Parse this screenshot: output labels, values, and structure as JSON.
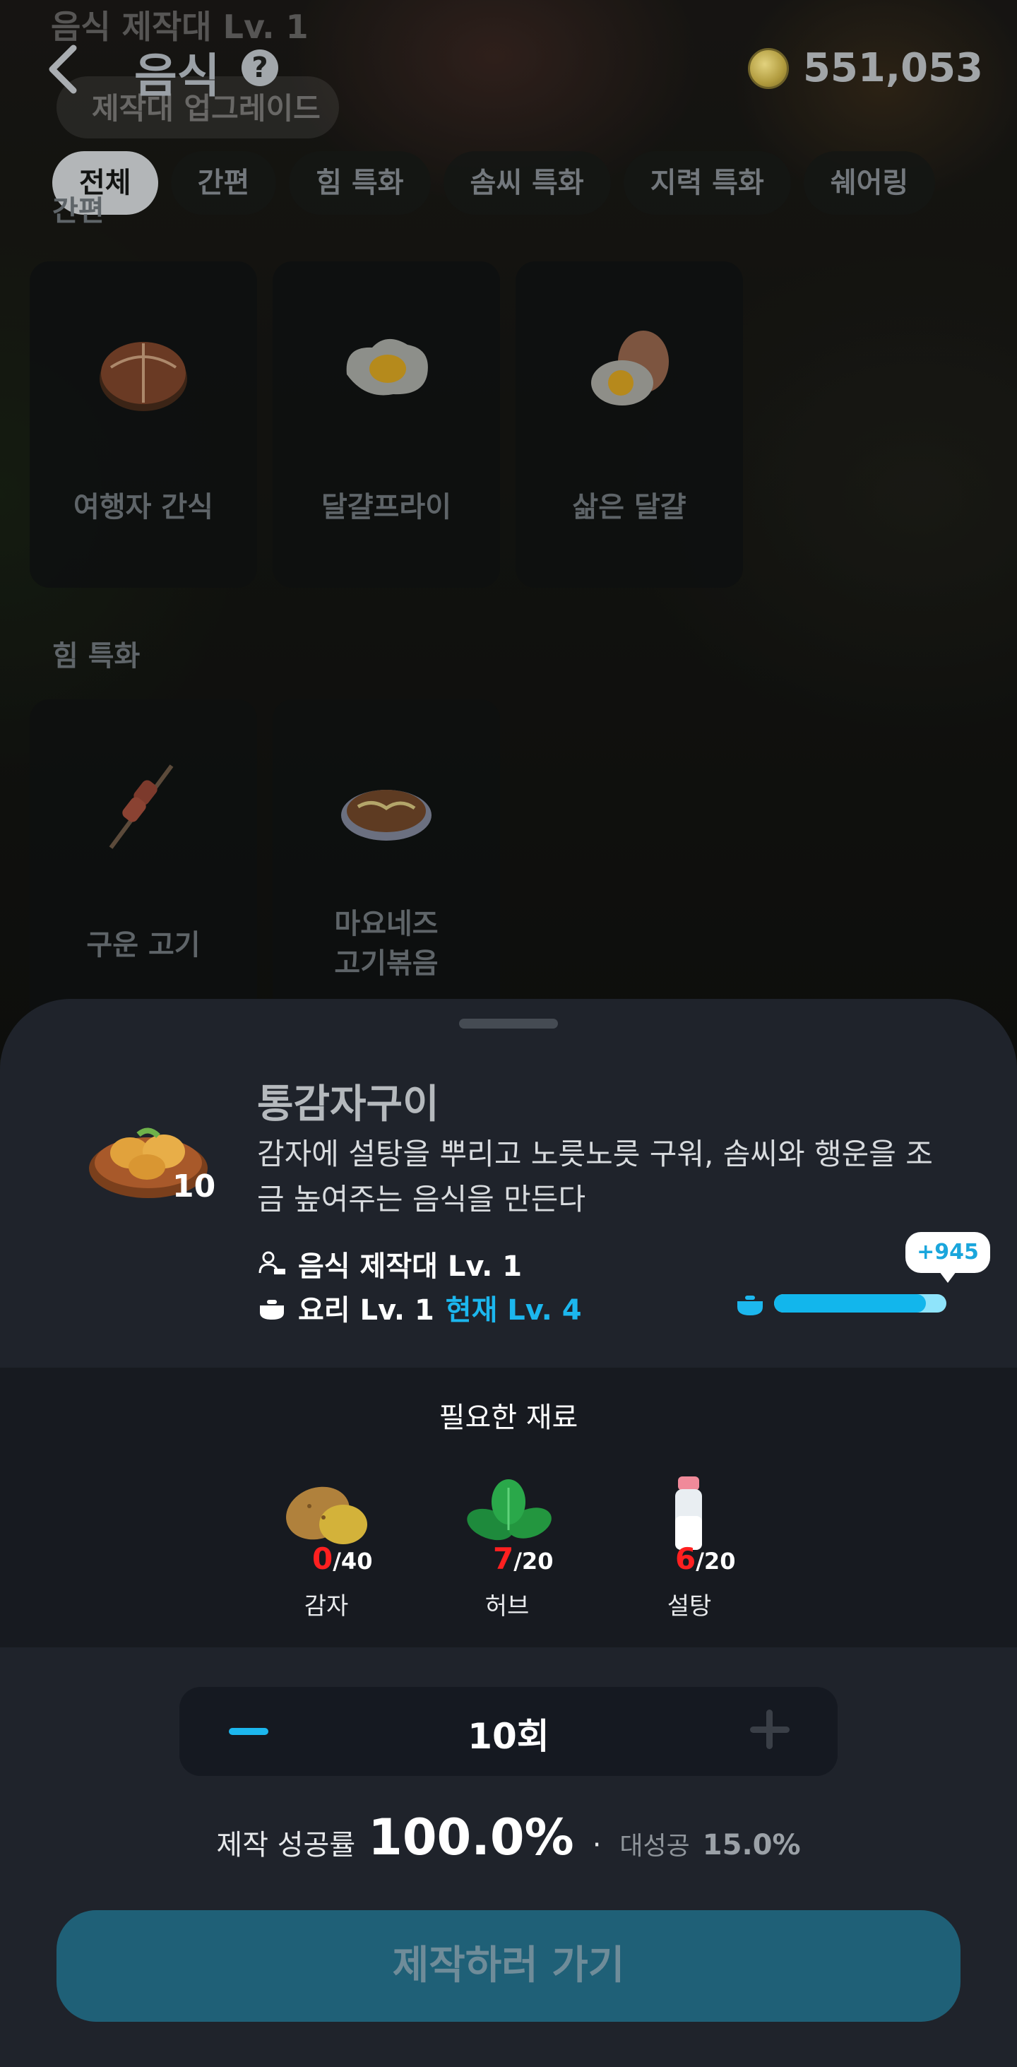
{
  "header": {
    "ghost_title": "음식 제작대 Lv. 1",
    "ghost_upgrade": "제작대 업그레이드",
    "title": "음식",
    "help": "?",
    "coins": "551,053"
  },
  "tabs": [
    "전체",
    "간편",
    "힘 특화",
    "솜씨 특화",
    "지력 특화",
    "쉐어링"
  ],
  "sections": [
    {
      "label": "간편",
      "items": [
        "여행자 간식",
        "달걀프라이",
        "삶은 달걀"
      ]
    },
    {
      "label": "힘 특화",
      "items": [
        "구운 고기",
        "마요네즈\n고기볶음"
      ]
    }
  ],
  "sheet": {
    "recipe_name": "통감자구이",
    "recipe_qty": "10",
    "description": "감자에 설탕을 뿌리고 노릇노릇 구워, 솜씨와 행운을 조금 높여주는 음식을 만든다",
    "req_station": "음식 제작대 Lv. 1",
    "req_cook": "요리 Lv. 1",
    "req_current": "현재 Lv. 4",
    "xp_gain": "+945",
    "xp_progress": 0.88,
    "materials_title": "필요한 재료",
    "materials": [
      {
        "name": "감자",
        "have": "0",
        "need": "/40"
      },
      {
        "name": "허브",
        "have": "7",
        "need": "/20"
      },
      {
        "name": "설탕",
        "have": "6",
        "need": "/20"
      }
    ],
    "count": "10회",
    "success_label": "제작 성공률",
    "success_value": "100.0%",
    "separator": "·",
    "great_label": "대성공",
    "great_value": "15.0%",
    "cta": "제작하러 가기"
  },
  "colors": {
    "accent": "#1cb7ee",
    "shortage": "#ff2020",
    "cta_bg": "#1f6077",
    "sheet_bg": "#1f232b"
  }
}
